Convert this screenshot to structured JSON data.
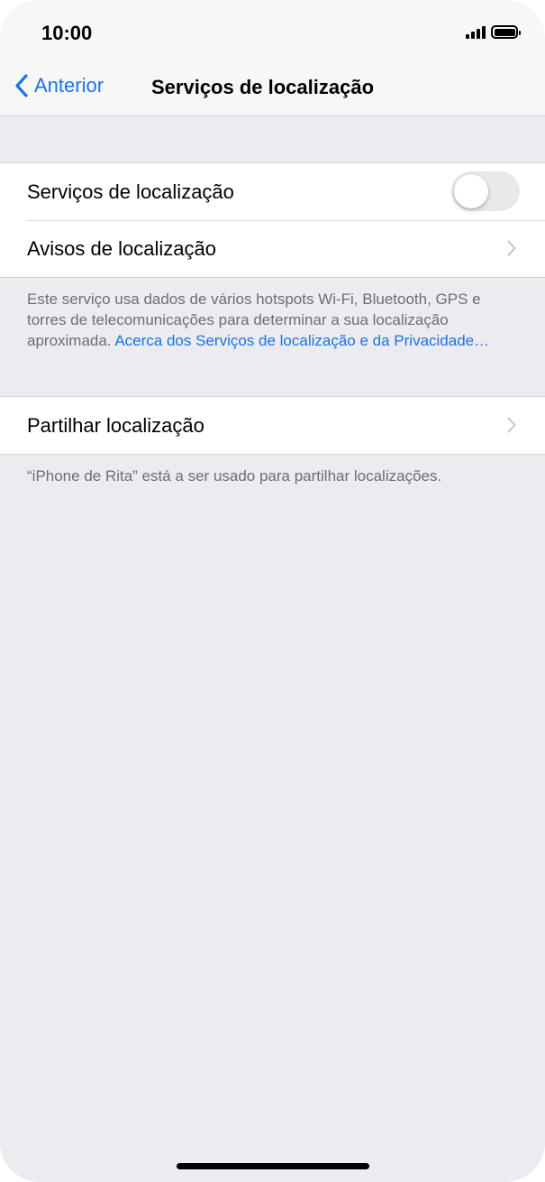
{
  "status_bar": {
    "time": "10:00",
    "signal_icon": "cellular-signal-icon",
    "battery_icon": "battery-icon",
    "battery_level": 1.0
  },
  "nav": {
    "back_label": "Anterior",
    "back_icon": "chevron-left-icon",
    "title": "Serviços de localização"
  },
  "location_section": {
    "toggle_row": {
      "label": "Serviços de localização",
      "toggle_on": false
    },
    "alerts_row": {
      "label": "Avisos de localização",
      "icon": "chevron-right-icon"
    }
  },
  "location_footnote": {
    "text": "Este serviço usa dados de vários hotspots Wi-Fi, Bluetooth, GPS e torres de telecomunicações para determinar a sua localização aproximada. ",
    "link": "Acerca dos Serviços de localização e da Privacidade…"
  },
  "share_section": {
    "row": {
      "label": "Partilhar localização",
      "icon": "chevron-right-icon"
    }
  },
  "share_footnote": {
    "text": "“iPhone de Rita” está a ser usado para partilhar localizações."
  },
  "colors": {
    "accent": "#1a73e8",
    "background": "#ebebf0",
    "cell": "#ffffff",
    "footnote": "#6d6d72",
    "toggle_off": "#e9e9eb"
  }
}
